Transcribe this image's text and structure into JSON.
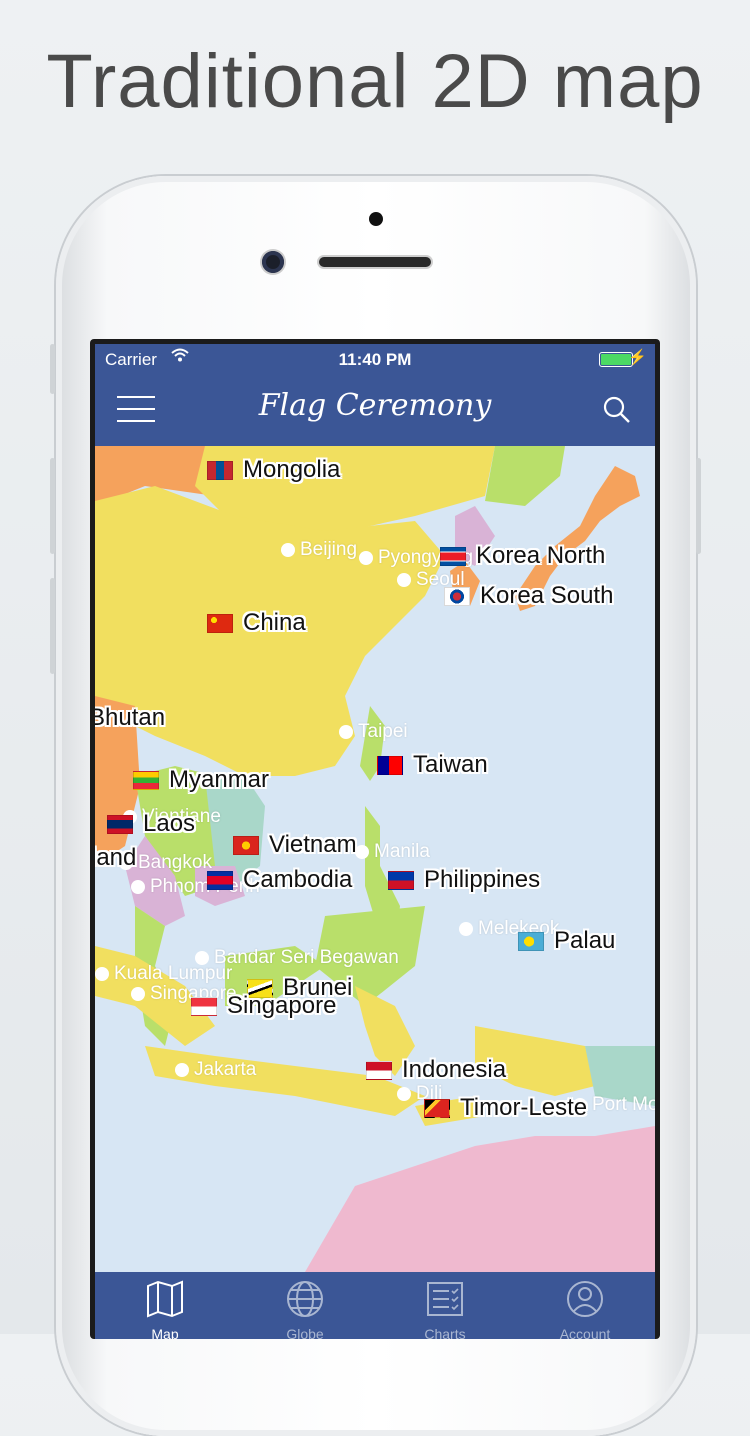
{
  "headline": "Traditional 2D map",
  "status": {
    "carrier": "Carrier",
    "time": "11:40 PM"
  },
  "navbar": {
    "logo_text": "Flag Ceremony"
  },
  "map": {
    "countries": [
      {
        "name": "Mongolia",
        "flag": [
          "#c4272f",
          "#015197",
          "#c4272f"
        ]
      },
      {
        "name": "Korea North",
        "flag": [
          "#024fa2",
          "#ed1c27",
          "#024fa2"
        ]
      },
      {
        "name": "Korea South",
        "flag": [
          "#ffffff",
          "#ffffff",
          "#ffffff"
        ]
      },
      {
        "name": "China",
        "flag": [
          "#de2910",
          "#de2910",
          "#de2910"
        ]
      },
      {
        "name": "Bhutan",
        "flag": []
      },
      {
        "name": "Taiwan",
        "flag": [
          "#fe0000",
          "#000095",
          "#fe0000"
        ]
      },
      {
        "name": "Myanmar",
        "flag": [
          "#fecb00",
          "#34b233",
          "#ea2839"
        ]
      },
      {
        "name": "Laos",
        "flag": [
          "#ce1126",
          "#002868",
          "#ce1126"
        ]
      },
      {
        "name": "Vietnam",
        "flag": [
          "#da251d",
          "#da251d",
          "#da251d"
        ]
      },
      {
        "name": "land",
        "flag": []
      },
      {
        "name": "Cambodia",
        "flag": [
          "#032ea1",
          "#e00025",
          "#032ea1"
        ]
      },
      {
        "name": "Philippines",
        "flag": [
          "#0038a8",
          "#ce1126",
          "#ffffff"
        ]
      },
      {
        "name": "Palau",
        "flag": [
          "#4aadd6",
          "#4aadd6",
          "#4aadd6"
        ]
      },
      {
        "name": "Brunei",
        "flag": [
          "#f7e017",
          "#ffffff",
          "#000000"
        ]
      },
      {
        "name": "Singapore",
        "flag": [
          "#ef3340",
          "#ffffff",
          "#ffffff"
        ]
      },
      {
        "name": "Indonesia",
        "flag": [
          "#ce1126",
          "#ffffff",
          "#ffffff"
        ]
      },
      {
        "name": "Timor-Leste",
        "flag": [
          "#dc241f",
          "#000000",
          "#dc241f"
        ]
      }
    ],
    "cities": [
      "Beijing",
      "Pyongyang",
      "Seoul",
      "Taipei",
      "Vientiane",
      "Bangkok",
      "Phnom Penh",
      "Manila",
      "Melekeok",
      "Bandar Seri Begawan",
      "Kuala Lumpur",
      "Singapore",
      "Jakarta",
      "Dili",
      "Port Moresby"
    ]
  },
  "tabs": [
    {
      "label": "Map",
      "active": true
    },
    {
      "label": "Globe",
      "active": false
    },
    {
      "label": "Charts",
      "active": false
    },
    {
      "label": "Account",
      "active": false
    }
  ]
}
